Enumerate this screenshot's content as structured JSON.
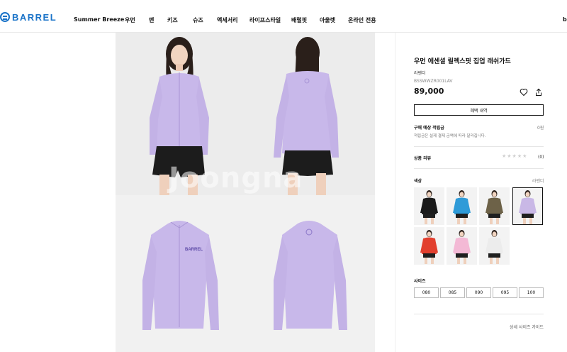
{
  "brand": {
    "logo_text": "BARREL",
    "accent": "#1a73c8"
  },
  "nav": {
    "items": [
      "Summer Breeze",
      "우먼",
      "맨",
      "키즈",
      "슈즈",
      "액세서리",
      "라이프스타일",
      "배럴핏",
      "아울렛",
      "온라인 전용"
    ],
    "cut_item": "b"
  },
  "gallery": {
    "watermark": "Joongna"
  },
  "product": {
    "title": "우먼 에센셜 릴렉스핏 집업 래쉬가드",
    "color_name": "라벤더",
    "code": "BSSWWZR001LAV",
    "price": "89,000",
    "benefit_button": "혜택 내역",
    "points": {
      "label": "구매 예상 적립금",
      "value": "0원",
      "note": "적립금은 실제 결제 금액에 따라 달라집니다."
    },
    "review": {
      "label": "상품 리뷰",
      "stars": "★★★★★",
      "count": "(0)"
    },
    "colors": {
      "label": "색상",
      "selected": "라벤더"
    },
    "sizes": {
      "label": "사이즈",
      "options": [
        "080",
        "085",
        "090",
        "095",
        "100"
      ]
    },
    "size_guide": "상세 사이즈 가이드"
  },
  "swatch_colors": [
    "#1b1b1b",
    "#2f9bd8",
    "#6d6248",
    "#c9b8e6",
    "#e2402f",
    "#f3b9d5",
    "#ececec"
  ],
  "garment_color": "#c8b8ea"
}
